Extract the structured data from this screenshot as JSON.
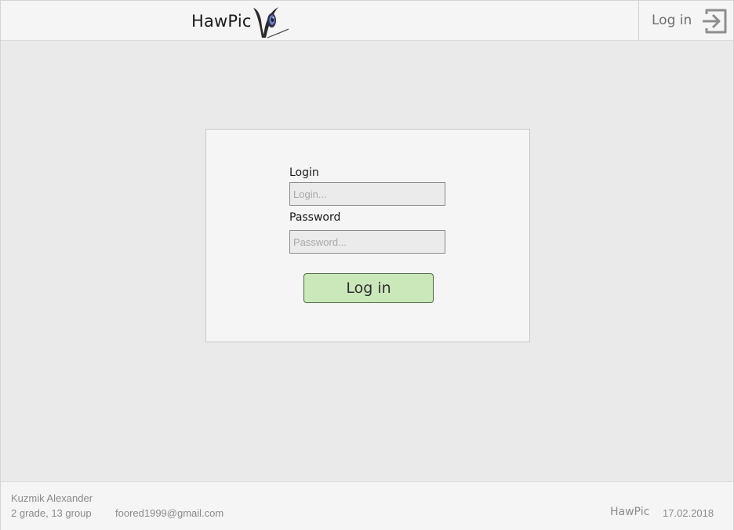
{
  "header": {
    "logo_text": "HawPic",
    "login_label": "Log in",
    "logo_icon": "hawk-eye-logo",
    "login_icon": "sign-in-icon"
  },
  "login_form": {
    "login_label": "Login",
    "login_placeholder": "Login...",
    "login_value": "",
    "password_label": "Password",
    "password_placeholder": "Password...",
    "password_value": "",
    "submit_label": "Log in"
  },
  "footer": {
    "author_name": "Kuzmik Alexander",
    "author_group": "2 grade, 13 group",
    "author_email": "foored1999@gmail.com",
    "brand": "HawPic",
    "date": "17.02.2018"
  },
  "colors": {
    "page_background": "#eaeaea",
    "panel_background": "#f5f5f5",
    "button_background": "#cbe8bb",
    "button_border": "#4d6b45",
    "muted_text": "#8b8b8b"
  }
}
